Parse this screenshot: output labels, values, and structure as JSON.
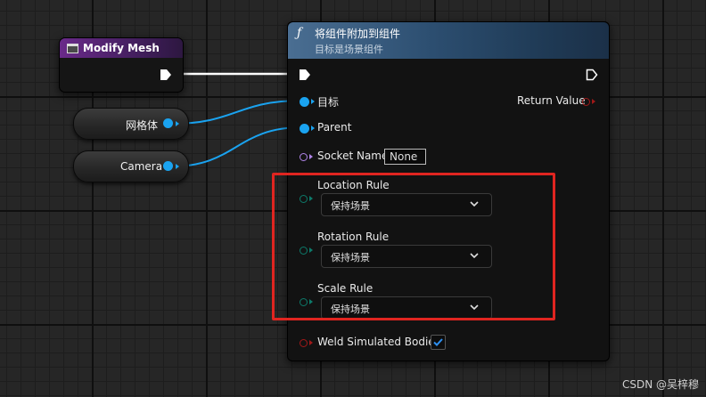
{
  "event_node": {
    "title": "Modify Mesh"
  },
  "variables": [
    {
      "label": "网格体"
    },
    {
      "label": "Camera"
    }
  ],
  "function_node": {
    "icon": "function-f-icon",
    "title": "将组件附加到组件",
    "subtitle": "目标是场景组件",
    "pins": {
      "target": "目标",
      "parent": "Parent",
      "socket_name": "Socket Name",
      "socket_value": "None",
      "location_rule": "Location Rule",
      "location_value": "保持场景",
      "rotation_rule": "Rotation Rule",
      "rotation_value": "保持场景",
      "scale_rule": "Scale Rule",
      "scale_value": "保持场景",
      "weld": "Weld Simulated Bodies",
      "weld_checked": true,
      "return_value": "Return Value"
    }
  },
  "colors": {
    "object_pin": "#1aa3f0",
    "name_pin": "#b084e8",
    "enum_pin": "#0d7a6a",
    "bool_pin": "#a01818",
    "highlight": "#e02520"
  },
  "watermark": "CSDN @吴梓穆"
}
